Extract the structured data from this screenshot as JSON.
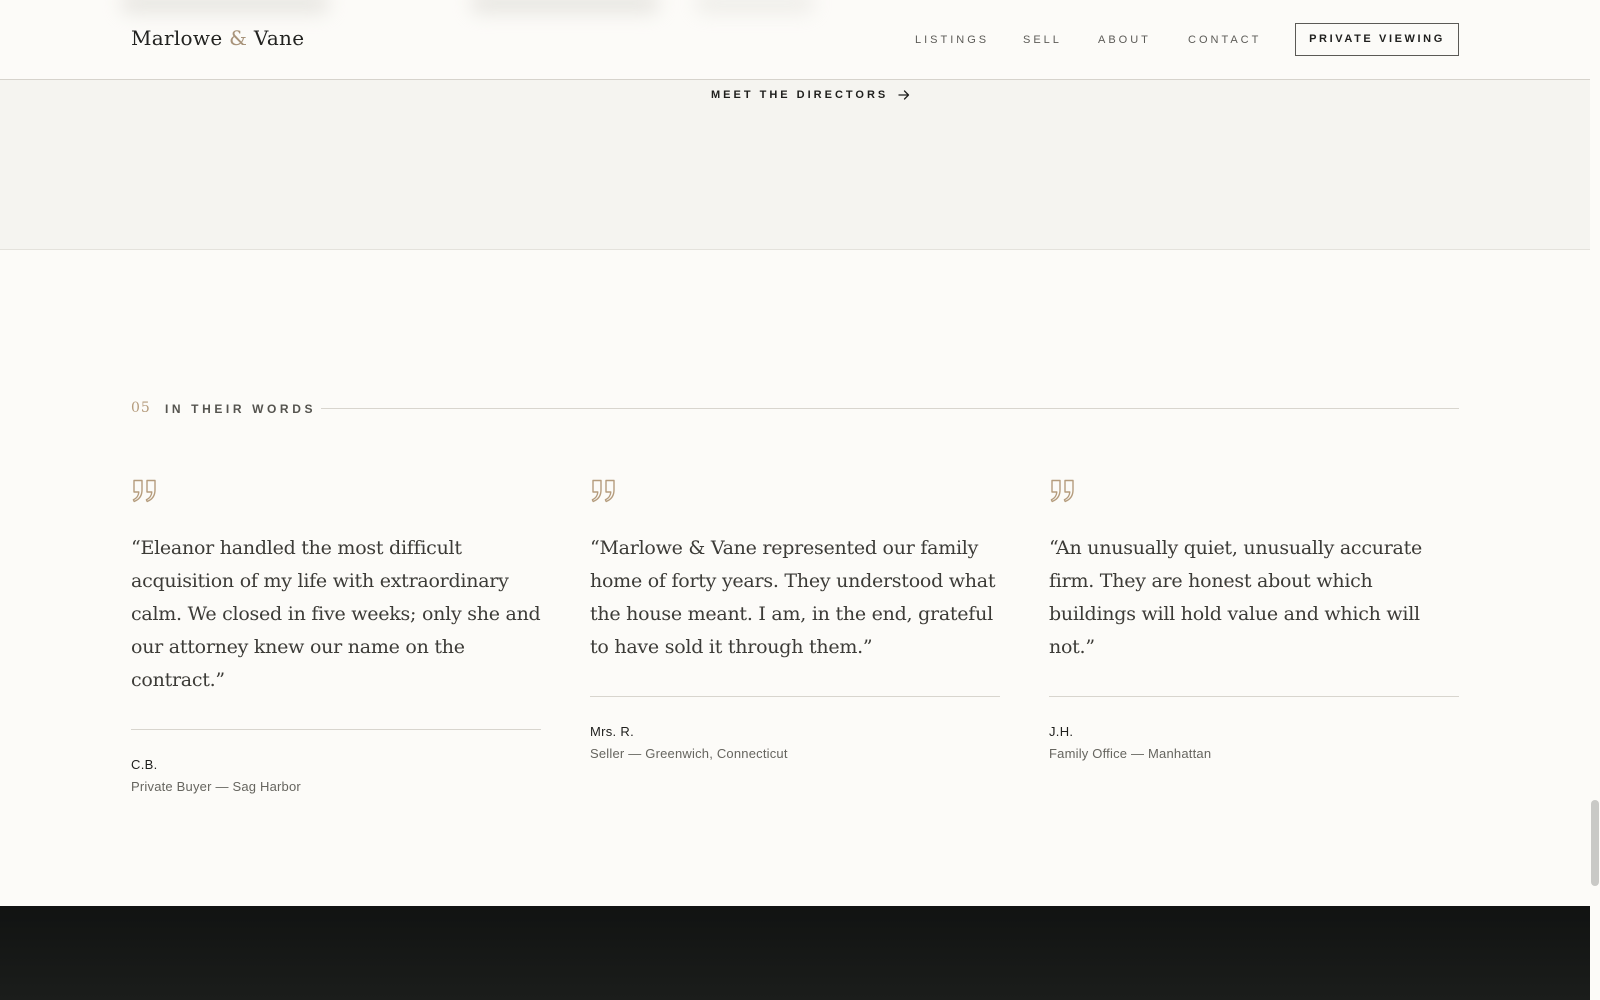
{
  "brand": {
    "name_first": "Marlowe",
    "name_amp": "&",
    "name_last": "Vane"
  },
  "nav": {
    "items": [
      "LISTINGS",
      "SELL",
      "ABOUT",
      "CONTACT"
    ],
    "cta_label": "PRIVATE VIEWING"
  },
  "directors_link": {
    "label": "MEET THE DIRECTORS",
    "icon": "arrow-right-icon"
  },
  "section": {
    "number": "05",
    "title": "IN THEIR WORDS"
  },
  "testimonials": [
    {
      "icon": "quote-icon",
      "quote": "“Eleanor handled the most difficult acquisition of my life with extraordinary calm. We closed in five weeks; only she and our attorney knew our name on the contract.”",
      "author": "C.B.",
      "role": "Private Buyer — Sag Harbor"
    },
    {
      "icon": "quote-icon",
      "quote": "“Marlowe & Vane represented our family home of forty years. They understood what the house meant. I am, in the end, grateful to have sold it through them.”",
      "author": "Mrs. R.",
      "role": "Seller — Greenwich, Connecticut"
    },
    {
      "icon": "quote-icon",
      "quote": "“An unusually quiet, unusually accurate firm. They are honest about which buildings will hold value and which will not.”",
      "author": "J.H.",
      "role": "Family Office — Manhattan"
    }
  ],
  "colors": {
    "background": "#fcfbf8",
    "accent_gold": "#b59c7d",
    "text_dark": "#1d1d1b",
    "dark_band": "#151716"
  }
}
